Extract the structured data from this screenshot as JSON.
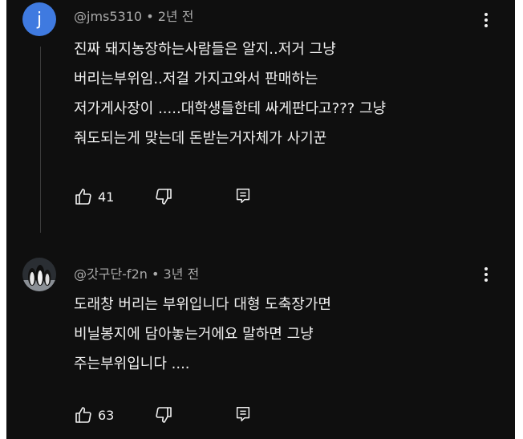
{
  "comments": [
    {
      "avatar_letter": "j",
      "avatar_color": "#3f7ae0",
      "author": "@jms5310",
      "separator": "•",
      "time": "2년 전",
      "lines": [
        "진짜 돼지농장하는사람들은 알지..저거 그냥",
        "버리는부위임..저걸 가지고와서 판매하는",
        "저가게사장이 .....대학생들한테 싸게판다고???  그냥",
        "줘도되는게 맞는데 돈받는거자체가 사기꾼"
      ],
      "likes": "41",
      "like_icon": "thumbs-up-icon",
      "dislike_icon": "thumbs-down-icon",
      "reply_icon": "reply-icon"
    },
    {
      "avatar_image": "avatar-penguins-icon",
      "author": "@갓구단-f2n",
      "separator": "•",
      "time": "3년 전",
      "lines": [
        "도래창 버리는 부위입니다 대형 도축장가면",
        "비닐봉지에 담아놓는거에요 말하면 그냥",
        "주는부위입니다 ...."
      ],
      "likes": "63",
      "like_icon": "thumbs-up-icon",
      "dislike_icon": "thumbs-down-icon",
      "reply_icon": "reply-icon"
    }
  ],
  "colors": {
    "background": "#0f0f0f",
    "text": "#f1f1f1",
    "meta": "#aaaaaa",
    "avatar_blue": "#3f7ae0"
  }
}
